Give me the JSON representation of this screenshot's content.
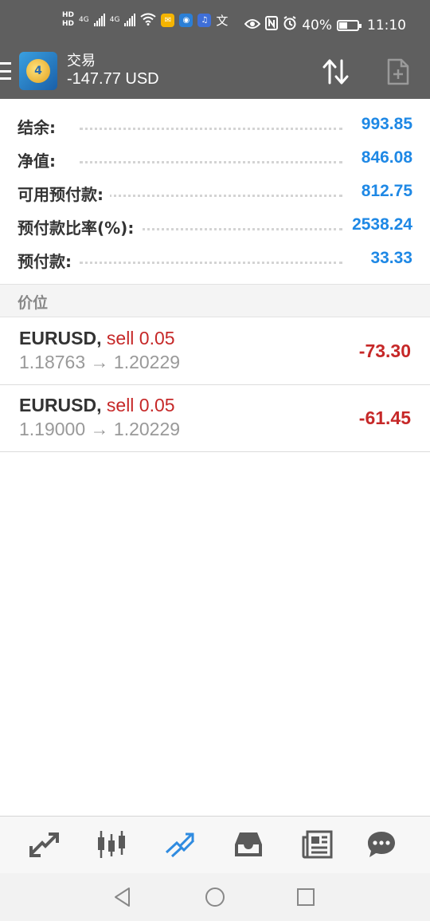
{
  "status_bar": {
    "hd1": "HD",
    "hd2": "HD",
    "net1": "4G",
    "net2": "4G",
    "battery_percent": "40%",
    "battery_level": 0.4,
    "time": "11:10"
  },
  "header": {
    "title": "交易",
    "subtitle": "-147.77 USD"
  },
  "summary": [
    {
      "label": "结余:",
      "value": "993.85"
    },
    {
      "label": "净值:",
      "value": "846.08"
    },
    {
      "label": "可用预付款:",
      "value": "812.75"
    },
    {
      "label": "预付款比率(%):",
      "value": "2538.24"
    },
    {
      "label": "预付款:",
      "value": "33.33"
    }
  ],
  "section_title": "价位",
  "positions": [
    {
      "symbol": "EURUSD,",
      "direction": "sell 0.05",
      "prices": "1.18763 → 1.20229",
      "profit": "-73.30"
    },
    {
      "symbol": "EURUSD,",
      "direction": "sell 0.05",
      "prices": "1.19000 → 1.20229",
      "profit": "-61.45"
    }
  ],
  "bottom_nav": [
    {
      "icon": "quotes-icon"
    },
    {
      "icon": "chart-icon"
    },
    {
      "icon": "trade-icon",
      "active": true
    },
    {
      "icon": "history-icon"
    },
    {
      "icon": "news-icon"
    },
    {
      "icon": "chat-icon"
    }
  ],
  "colors": {
    "header_bg": "#5f5f5f",
    "value_blue": "#1e88e5",
    "loss_red": "#c62828",
    "active_nav": "#2f8be0"
  }
}
